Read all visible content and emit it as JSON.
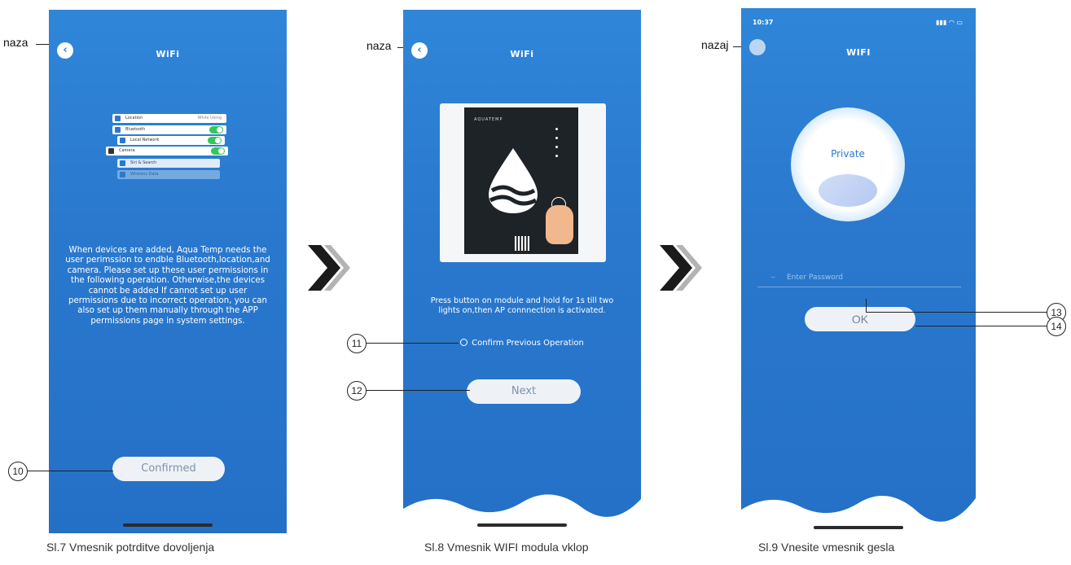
{
  "screen1": {
    "title": "WiFi",
    "back_label": "naza",
    "permissions": [
      {
        "label": "Location",
        "value": "While Using",
        "toggle": false
      },
      {
        "label": "Bluetooth",
        "toggle": true
      },
      {
        "label": "Local Network",
        "toggle": true
      },
      {
        "label": "Camera",
        "toggle": true
      },
      {
        "label": "Siri & Search",
        "toggle": false
      },
      {
        "label": "Wireless Data",
        "toggle": false
      }
    ],
    "message": "When devices are added, Aqua Temp needs the user perimssion to endble Bluetooth,location,and camera. Please set up these user permissions in the following operation. Otherwise,the devices cannot be added If cannot set up user permissions due to incorrect operation, you can also set up them manually through the APP permissions page in system settings.",
    "button_label": "Confirmed",
    "callout": "10",
    "caption": "Sl.7 Vmesnik potrditve dovoljenja"
  },
  "screen2": {
    "title": "WiFi",
    "back_label": "naza",
    "device_brand": "AQUATEMP",
    "instruction": "Press button on module and hold for 1s till two lights on,then AP connnection is activated.",
    "confirm_label": "Confirm Previous Operation",
    "button_label": "Next",
    "callouts": [
      "11",
      "12"
    ],
    "caption": "Sl.8 Vmesnik WIFI modula vklop"
  },
  "screen3": {
    "title": "WIFI",
    "back_label": "nazaj",
    "time": "10:37",
    "orb_label": "Private",
    "password_placeholder": "Enter Password",
    "button_label": "OK",
    "callouts": [
      "13",
      "14"
    ],
    "caption": "Sl.9 Vnesite vmesnik gesla"
  },
  "colors": {
    "phone_bg": "#2a79cf",
    "button_bg": "#eef2f7",
    "arrow_dark": "#1a1a1a",
    "arrow_light": "#b3b3b3",
    "toggle_on": "#34c759"
  }
}
